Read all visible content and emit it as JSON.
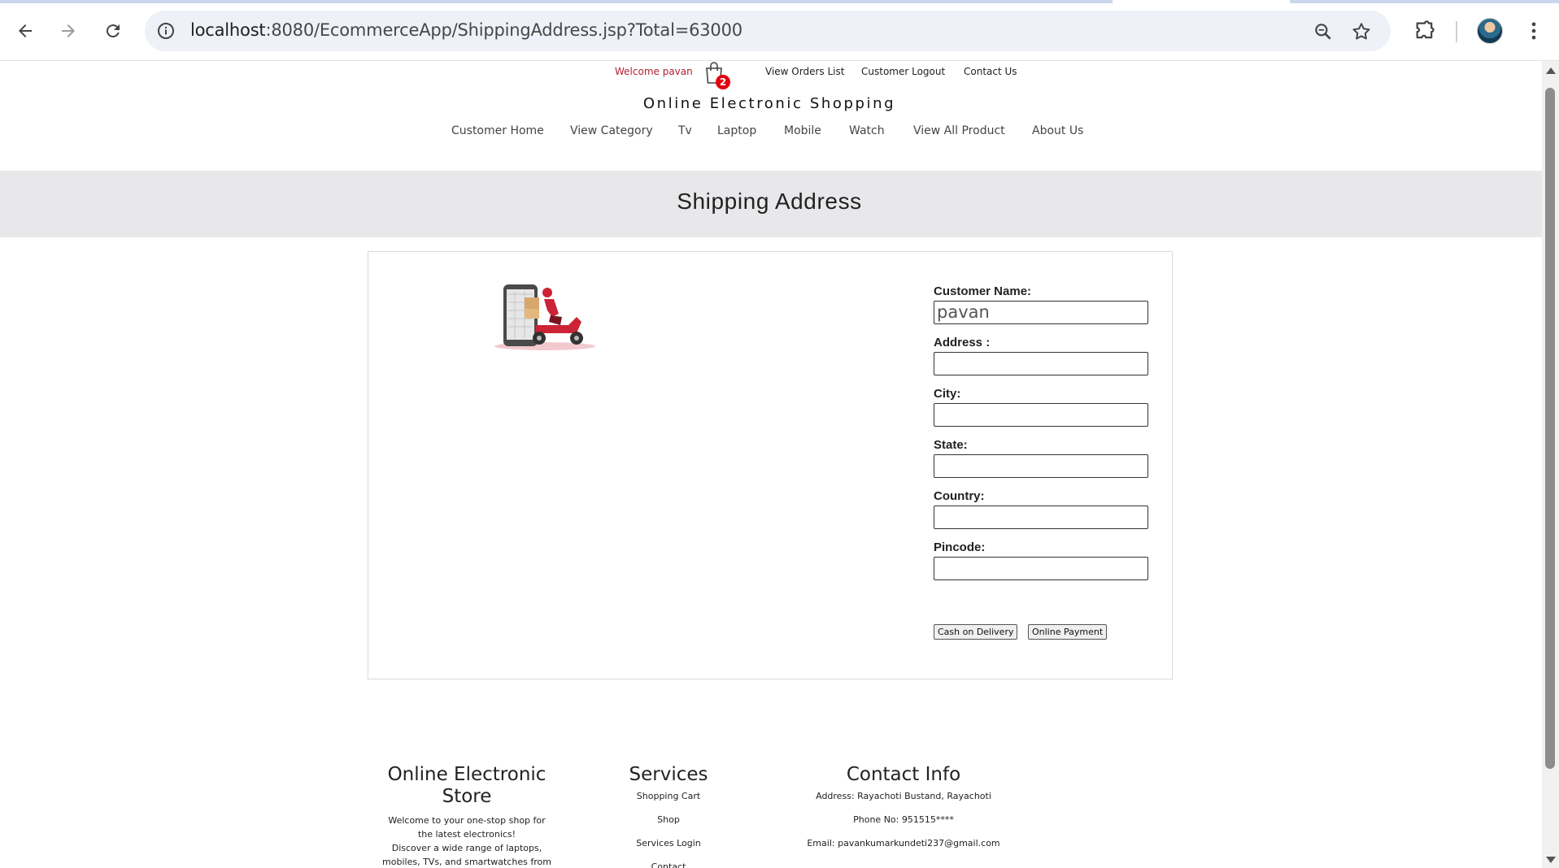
{
  "browser": {
    "url_host": "localhost",
    "url_path": ":8080/EcommerceApp/ShippingAddress.jsp?Total=63000",
    "icons": [
      "back-arrow-icon",
      "forward-arrow-icon",
      "reload-icon",
      "site-info-icon",
      "zoom-icon",
      "bookmark-star-icon",
      "extensions-puzzle-icon",
      "profile-avatar",
      "more-menu-icon"
    ]
  },
  "topbar": {
    "welcome": "Welcome pavan",
    "cart_count": "2",
    "links": [
      "View Orders List",
      "Customer Logout",
      "Contact Us"
    ]
  },
  "site": {
    "title": "Online Electronic Shopping"
  },
  "menu": [
    "Customer Home",
    "View Category",
    "Tv",
    "Laptop",
    "Mobile",
    "Watch",
    "View All Product",
    "About Us"
  ],
  "banner": {
    "title": "Shipping Address"
  },
  "form": {
    "fields": [
      {
        "label": "Customer Name:",
        "value": "pavan"
      },
      {
        "label": "Address :",
        "value": ""
      },
      {
        "label": "City:",
        "value": ""
      },
      {
        "label": "State:",
        "value": ""
      },
      {
        "label": "Country:",
        "value": ""
      },
      {
        "label": "Pincode:",
        "value": ""
      }
    ],
    "buttons": [
      "Cash on Delivery",
      "Online Payment"
    ]
  },
  "footer": {
    "store": {
      "title_line1": "Online Electronic",
      "title_line2": "Store",
      "lines": [
        "Welcome to your one-stop shop for",
        "the latest electronics!",
        "Discover a wide range of laptops,",
        "mobiles, TVs, and smartwatches from"
      ]
    },
    "services": {
      "title": "Services",
      "links": [
        "Shopping Cart",
        "Shop",
        "Services Login",
        "Contact"
      ]
    },
    "contact": {
      "title": "Contact Info",
      "lines": [
        "Address: Rayachoti Bustand, Rayachoti",
        "Phone No: 951515****",
        "Email: pavankumarkundeti237@gmail.com"
      ]
    }
  },
  "colors": {
    "welcome": "#b21f2d",
    "badge": "#e3000f",
    "banner_bg": "#e8e7ea"
  }
}
